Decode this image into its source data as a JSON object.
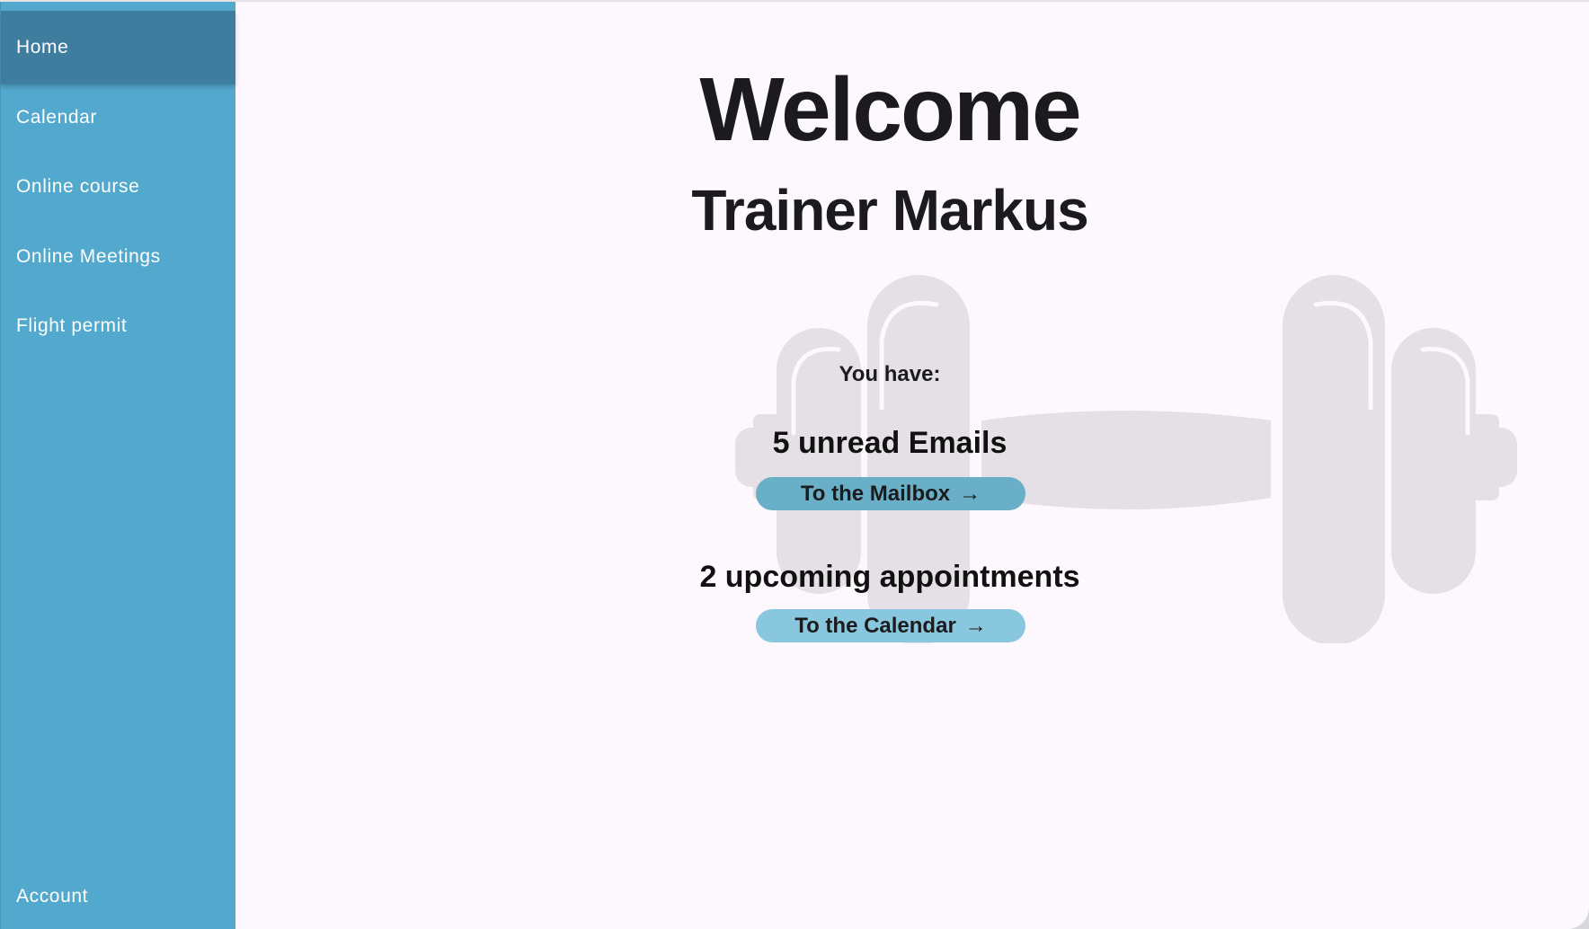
{
  "sidebar": {
    "items": [
      {
        "label": "Home",
        "active": true
      },
      {
        "label": "Calendar",
        "active": false
      },
      {
        "label": "Online course",
        "active": false
      },
      {
        "label": "Online Meetings",
        "active": false
      },
      {
        "label": "Flight permit",
        "active": false
      }
    ],
    "account_label": "Account"
  },
  "main": {
    "title": "Welcome",
    "subtitle": "Trainer Markus",
    "you_have": "You have:",
    "emails": {
      "text": "5 unread Emails",
      "button_label": "To the Mailbox",
      "button_icon": "arrow-right-icon"
    },
    "appointments": {
      "text": "2 upcoming appointments",
      "button_label": "To the Calendar",
      "button_icon": "arrow-right-icon"
    },
    "background_icon": "dumbbell-icon"
  },
  "colors": {
    "sidebar": "#52a8cd",
    "sidebar_active": "#3f7d9e",
    "button": "#89c7df",
    "button_hover": "#6aafc8",
    "background": "#fdf8fd",
    "watermark": "#e4e0e5"
  }
}
